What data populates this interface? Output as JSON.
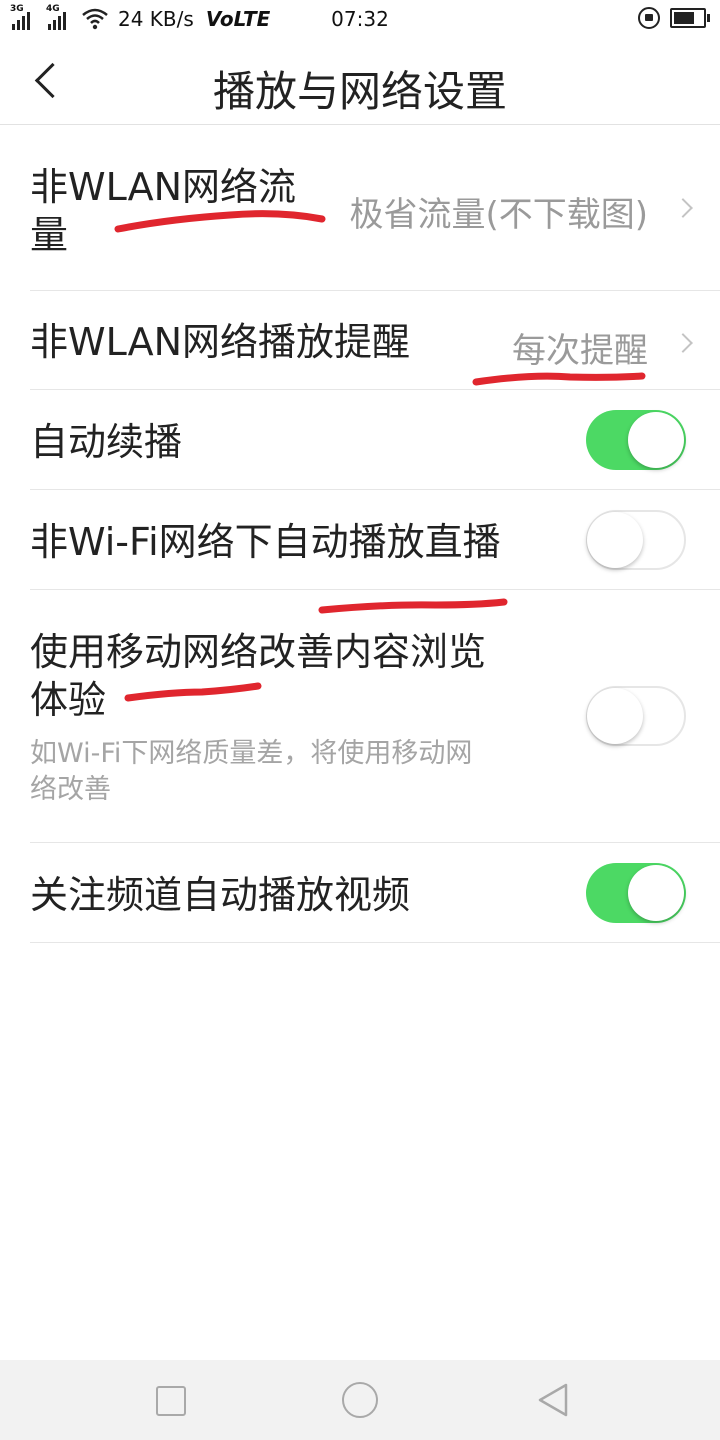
{
  "status_bar": {
    "net1": "3G",
    "net2": "4G",
    "speed": "24 KB/s",
    "volte": "VoLTE",
    "time": "07:32"
  },
  "header": {
    "title": "播放与网络设置"
  },
  "settings": {
    "row1": {
      "label_line1": "非WLAN网络流",
      "label_line2": "量",
      "value": "极省流量(不下载图)"
    },
    "row2": {
      "label": "非WLAN网络播放提醒",
      "value": "每次提醒"
    },
    "row3": {
      "label": "自动续播",
      "enabled": true
    },
    "row4": {
      "label": "非Wi-Fi网络下自动播放直播",
      "enabled": false
    },
    "row5": {
      "label_line1": "使用移动网络改善内容浏览",
      "label_line2": "体验",
      "desc_line1": "如Wi-Fi下网络质量差，将使用移动网",
      "desc_line2": "络改善",
      "enabled": false
    },
    "row6": {
      "label": "关注频道自动播放视频",
      "enabled": true
    }
  },
  "colors": {
    "toggle_on": "#4cd964",
    "annotation": "#e0262e"
  }
}
